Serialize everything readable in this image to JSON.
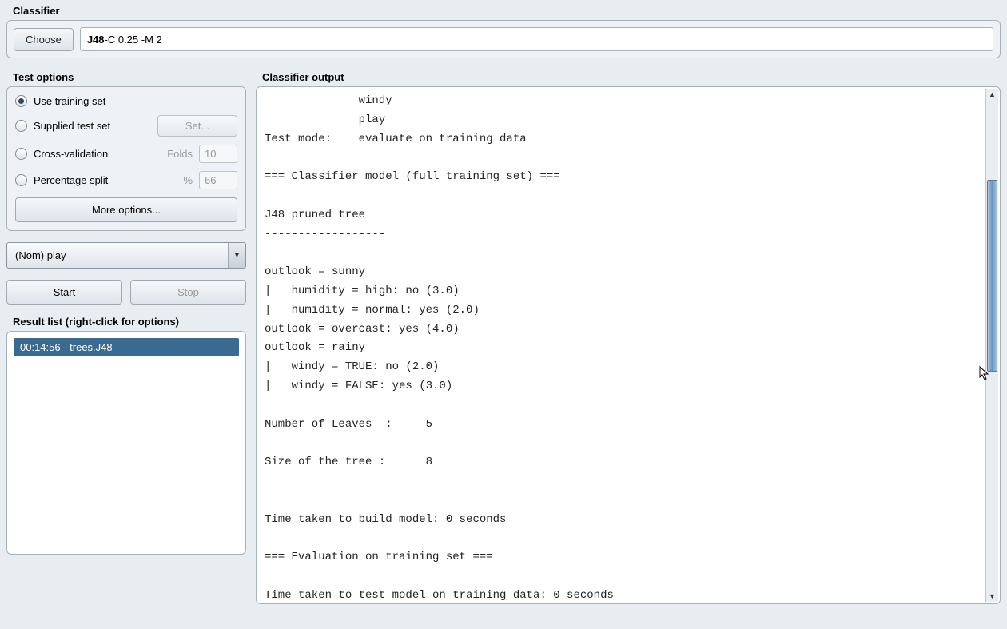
{
  "classifier": {
    "title": "Classifier",
    "choose_label": "Choose",
    "name": "J48",
    "params": " -C 0.25 -M 2"
  },
  "test_options": {
    "title": "Test options",
    "use_training": "Use training set",
    "supplied": "Supplied test set",
    "set_btn": "Set...",
    "cross_val": "Cross-validation",
    "folds_label": "Folds",
    "folds_value": "10",
    "pct_split": "Percentage split",
    "pct_label": "%",
    "pct_value": "66",
    "more_options": "More options..."
  },
  "attribute_select": "(Nom) play",
  "start_label": "Start",
  "stop_label": "Stop",
  "result_list": {
    "title": "Result list (right-click for options)",
    "items": [
      "00:14:56 - trees.J48"
    ]
  },
  "output": {
    "title": "Classifier output",
    "text": "              windy\n              play\nTest mode:    evaluate on training data\n\n=== Classifier model (full training set) ===\n\nJ48 pruned tree\n------------------\n\noutlook = sunny\n|   humidity = high: no (3.0)\n|   humidity = normal: yes (2.0)\noutlook = overcast: yes (4.0)\noutlook = rainy\n|   windy = TRUE: no (2.0)\n|   windy = FALSE: yes (3.0)\n\nNumber of Leaves  :     5\n\nSize of the tree :      8\n\n\nTime taken to build model: 0 seconds\n\n=== Evaluation on training set ===\n\nTime taken to test model on training data: 0 seconds"
  }
}
